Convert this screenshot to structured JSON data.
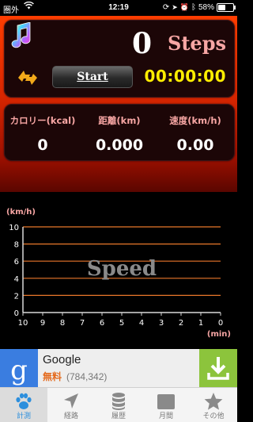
{
  "status_bar": {
    "carrier": "圏外",
    "time": "12:19",
    "battery": "58%",
    "battery_level": 0.58
  },
  "header": {
    "steps_value": "0",
    "steps_label": "Steps",
    "start_label": "Start",
    "timer": "00:00:00"
  },
  "stats": [
    {
      "label": "カロリー(kcal)",
      "value": "0"
    },
    {
      "label": "距離(km)",
      "value": "0.000"
    },
    {
      "label": "速度(km/h)",
      "value": "0.00"
    }
  ],
  "chart_data": {
    "type": "line",
    "title": "Speed",
    "ylabel": "(km/h)",
    "xlabel": "(min)",
    "ylim": [
      0,
      10
    ],
    "xlim": [
      10,
      0
    ],
    "y_ticks": [
      0,
      2,
      4,
      6,
      8,
      10
    ],
    "x_ticks": [
      10,
      9,
      8,
      7,
      6,
      5,
      4,
      3,
      2,
      1,
      0
    ],
    "grid": true,
    "series": [],
    "colors": {
      "grid": "#e8762a",
      "axis": "#d9d9d9",
      "label": "#f7a6a4",
      "tick": "#ffffff"
    }
  },
  "ad": {
    "title": "Google",
    "free_label": "無料",
    "reviews": "(784,342)"
  },
  "tabs": [
    {
      "label": "計測",
      "icon": "paw-icon",
      "active": true
    },
    {
      "label": "経路",
      "icon": "location-arrow-icon",
      "active": false
    },
    {
      "label": "履歴",
      "icon": "database-icon",
      "active": false
    },
    {
      "label": "月間",
      "icon": "calendar-icon",
      "active": false
    },
    {
      "label": "その他",
      "icon": "star-icon",
      "active": false
    }
  ],
  "colors": {
    "panel": "#1c0607",
    "accent_pink": "#f7a6a4",
    "timer_yellow": "#ffee00",
    "tab_active": "#2d8fdd"
  }
}
